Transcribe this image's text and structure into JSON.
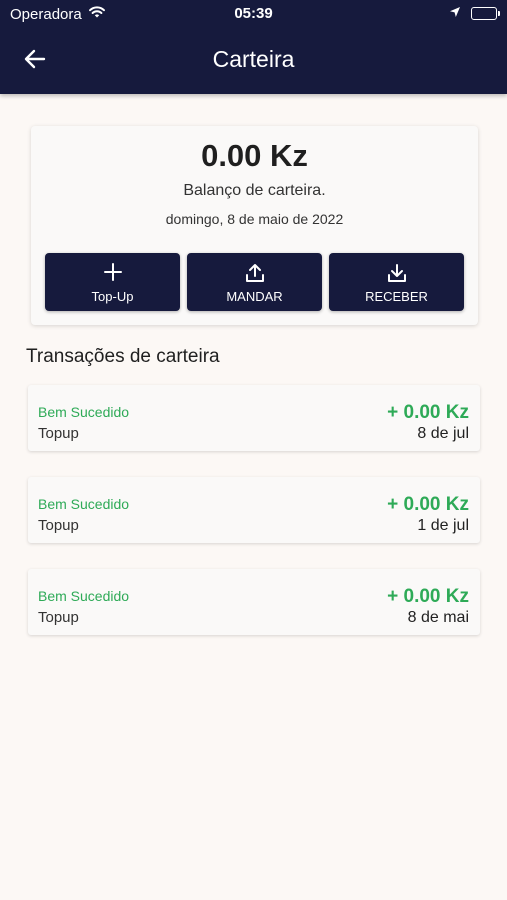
{
  "status_bar": {
    "carrier": "Operadora",
    "time": "05:39",
    "icons": [
      "wifi-icon",
      "location-arrow-icon",
      "battery-icon"
    ]
  },
  "header": {
    "back_icon": "arrow-left-icon",
    "title": "Carteira"
  },
  "wallet": {
    "amount": "0.00 Kz",
    "label": "Balanço de carteira.",
    "date": "domingo, 8 de maio de 2022",
    "actions": [
      {
        "label": "Top-Up",
        "icon": "plus-icon"
      },
      {
        "label": "MANDAR",
        "icon": "upload-icon"
      },
      {
        "label": "RECEBER",
        "icon": "download-icon"
      }
    ]
  },
  "transactions": {
    "title": "Transações de carteira",
    "items": [
      {
        "status": "Bem Sucedido",
        "type": "Topup",
        "amount": "+ 0.00 Kz",
        "date": "8 de jul"
      },
      {
        "status": "Bem Sucedido",
        "type": "Topup",
        "amount": "+ 0.00 Kz",
        "date": "1 de jul"
      },
      {
        "status": "Bem Sucedido",
        "type": "Topup",
        "amount": "+ 0.00 Kz",
        "date": "8 de mai"
      }
    ]
  },
  "colors": {
    "header_bg": "#161a3d",
    "button_bg": "#161a3d",
    "success_green": "#2eaa57",
    "page_bg": "#fcf8f5"
  }
}
